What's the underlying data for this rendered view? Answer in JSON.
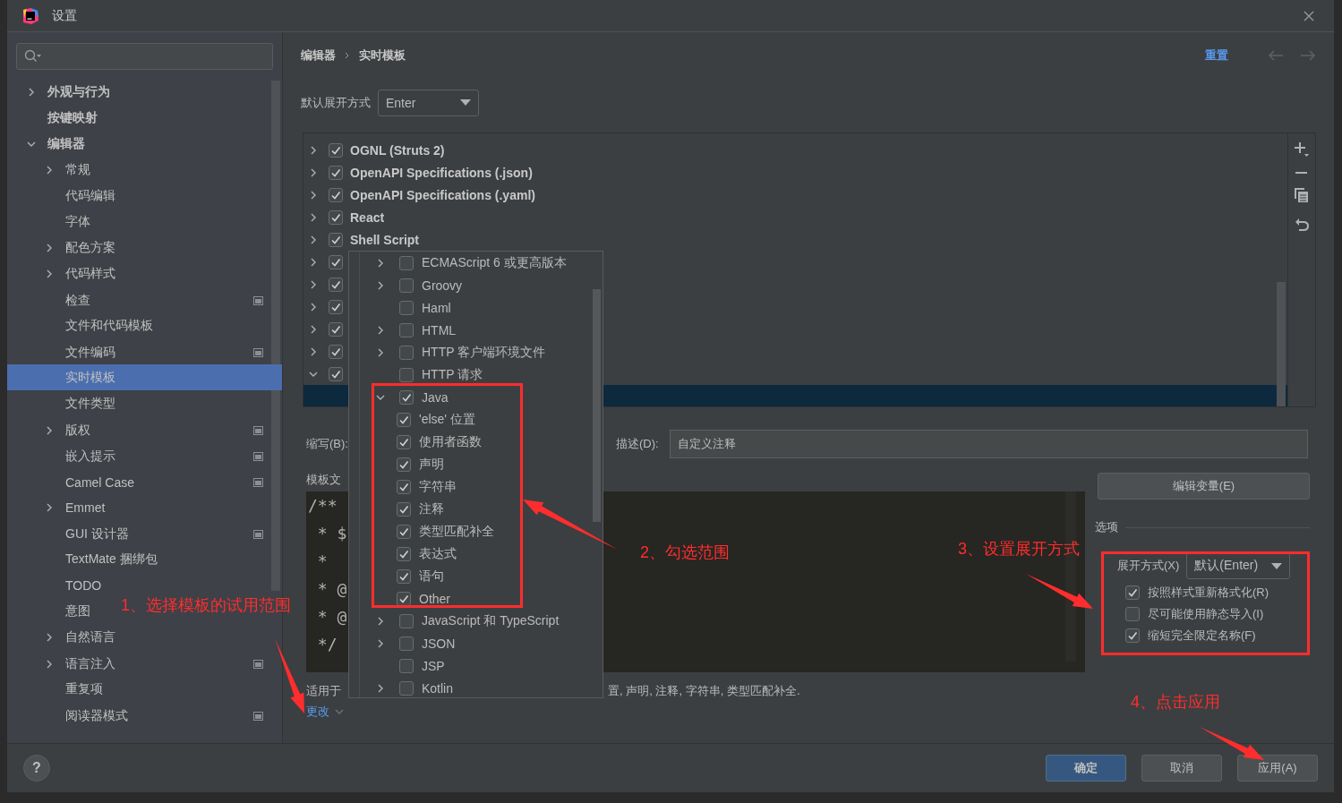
{
  "window": {
    "title": "设置"
  },
  "sidebar": {
    "items": [
      {
        "label": "外观与行为",
        "expanded": false,
        "selected": false,
        "project_scope": false
      },
      {
        "label": "按键映射",
        "selected": false,
        "project_scope": false
      },
      {
        "label": "编辑器",
        "expanded": true,
        "selected": false,
        "project_scope": false,
        "children": [
          {
            "label": "常规",
            "expanded": false,
            "selected": false,
            "project_scope": false
          },
          {
            "label": "代码编辑",
            "selected": false,
            "project_scope": false
          },
          {
            "label": "字体",
            "selected": false,
            "project_scope": false
          },
          {
            "label": "配色方案",
            "expanded": false,
            "selected": false,
            "project_scope": false
          },
          {
            "label": "代码样式",
            "expanded": false,
            "selected": false,
            "project_scope": false
          },
          {
            "label": "检查",
            "selected": false,
            "project_scope": true
          },
          {
            "label": "文件和代码模板",
            "selected": false,
            "project_scope": false
          },
          {
            "label": "文件编码",
            "selected": false,
            "project_scope": true
          },
          {
            "label": "实时模板",
            "selected": true,
            "project_scope": false
          },
          {
            "label": "文件类型",
            "selected": false,
            "project_scope": false
          },
          {
            "label": "版权",
            "expanded": false,
            "selected": false,
            "project_scope": true
          },
          {
            "label": "嵌入提示",
            "selected": false,
            "project_scope": true
          },
          {
            "label": "Camel Case",
            "selected": false,
            "project_scope": true
          },
          {
            "label": "Emmet",
            "expanded": false,
            "selected": false,
            "project_scope": false
          },
          {
            "label": "GUI 设计器",
            "selected": false,
            "project_scope": true
          },
          {
            "label": "TextMate 捆绑包",
            "selected": false,
            "project_scope": false
          },
          {
            "label": "TODO",
            "selected": false,
            "project_scope": false
          },
          {
            "label": "意图",
            "selected": false,
            "project_scope": false
          },
          {
            "label": "自然语言",
            "expanded": false,
            "selected": false,
            "project_scope": false
          },
          {
            "label": "语言注入",
            "expanded": false,
            "selected": false,
            "project_scope": true
          },
          {
            "label": "重复项",
            "selected": false,
            "project_scope": false
          },
          {
            "label": "阅读器模式",
            "selected": false,
            "project_scope": true
          }
        ]
      }
    ]
  },
  "help_button": "?",
  "breadcrumb": [
    "编辑器",
    "实时模板"
  ],
  "reset_link": "重置",
  "default_expand": {
    "label": "默认展开方式",
    "value": "Enter"
  },
  "template_groups": [
    {
      "label": "OGNL (Struts 2)",
      "checked": true,
      "expanded": false
    },
    {
      "label": "OpenAPI Specifications (.json)",
      "checked": true,
      "expanded": false
    },
    {
      "label": "OpenAPI Specifications (.yaml)",
      "checked": true,
      "expanded": false
    },
    {
      "label": "React",
      "checked": true,
      "expanded": false
    },
    {
      "label": "Shell Script",
      "checked": true,
      "expanded": false
    },
    {
      "checked": true,
      "expanded": false
    },
    {
      "checked": true,
      "expanded": false
    },
    {
      "checked": true,
      "expanded": false
    },
    {
      "checked": true,
      "expanded": false
    },
    {
      "checked": true,
      "expanded": false
    },
    {
      "checked": true,
      "expanded": true,
      "children": [
        {
          "selected": true
        }
      ]
    }
  ],
  "abbreviation": {
    "label": "缩写(B):"
  },
  "description": {
    "label": "描述(D):",
    "value": "自定义注释"
  },
  "template_text": {
    "label": "模板文",
    "lines": [
      "/**",
      " * $",
      " *",
      " * @",
      " * @",
      " */"
    ]
  },
  "edit_variables_button": "编辑变量(E)",
  "options": {
    "title": "选项",
    "expand_with": {
      "label": "展开方式(X)",
      "value": "默认(Enter)"
    },
    "checkboxes": [
      {
        "label": "按照样式重新格式化(R)",
        "checked": true
      },
      {
        "label": "尽可能使用静态导入(I)",
        "checked": false
      },
      {
        "label": "缩短完全限定名称(F)",
        "checked": true
      }
    ]
  },
  "applies_to": {
    "label": "适用于",
    "visible_tail": "置, 声明, 注释, 字符串, 类型匹配补全.",
    "change_link": "更改"
  },
  "context_popup": {
    "items": [
      {
        "label": "ECMAScript 6 或更高版本",
        "checked": false,
        "expanded": false
      },
      {
        "label": "Groovy",
        "checked": false,
        "expanded": false
      },
      {
        "label": "Haml",
        "checked": false
      },
      {
        "label": "HTML",
        "checked": false,
        "expanded": false
      },
      {
        "label": "HTTP 客户端环境文件",
        "checked": false,
        "expanded": false
      },
      {
        "label": "HTTP 请求",
        "checked": false
      },
      {
        "label": "Java",
        "checked": true,
        "expanded": true,
        "children": [
          {
            "label": "'else' 位置",
            "checked": true
          },
          {
            "label": "使用者函数",
            "checked": true
          },
          {
            "label": "声明",
            "checked": true
          },
          {
            "label": "字符串",
            "checked": true
          },
          {
            "label": "注释",
            "checked": true
          },
          {
            "label": "类型匹配补全",
            "checked": true
          },
          {
            "label": "表达式",
            "checked": true
          },
          {
            "label": "语句",
            "checked": true
          },
          {
            "label": "Other",
            "checked": true
          }
        ]
      },
      {
        "label": "JavaScript 和 TypeScript",
        "checked": false,
        "expanded": false
      },
      {
        "label": "JSON",
        "checked": false,
        "expanded": false
      },
      {
        "label": "JSP",
        "checked": false
      },
      {
        "label": "Kotlin",
        "checked": false,
        "expanded": false
      }
    ]
  },
  "buttons": [
    {
      "label": "确定",
      "primary": true
    },
    {
      "label": "取消",
      "primary": false
    },
    {
      "label": "应用(A)",
      "primary": false
    }
  ],
  "annotations": [
    {
      "text": "1、选择模板的试用范围"
    },
    {
      "text": "2、勾选范围"
    },
    {
      "text": "3、设置展开方式"
    },
    {
      "text": "4、点击应用"
    }
  ]
}
